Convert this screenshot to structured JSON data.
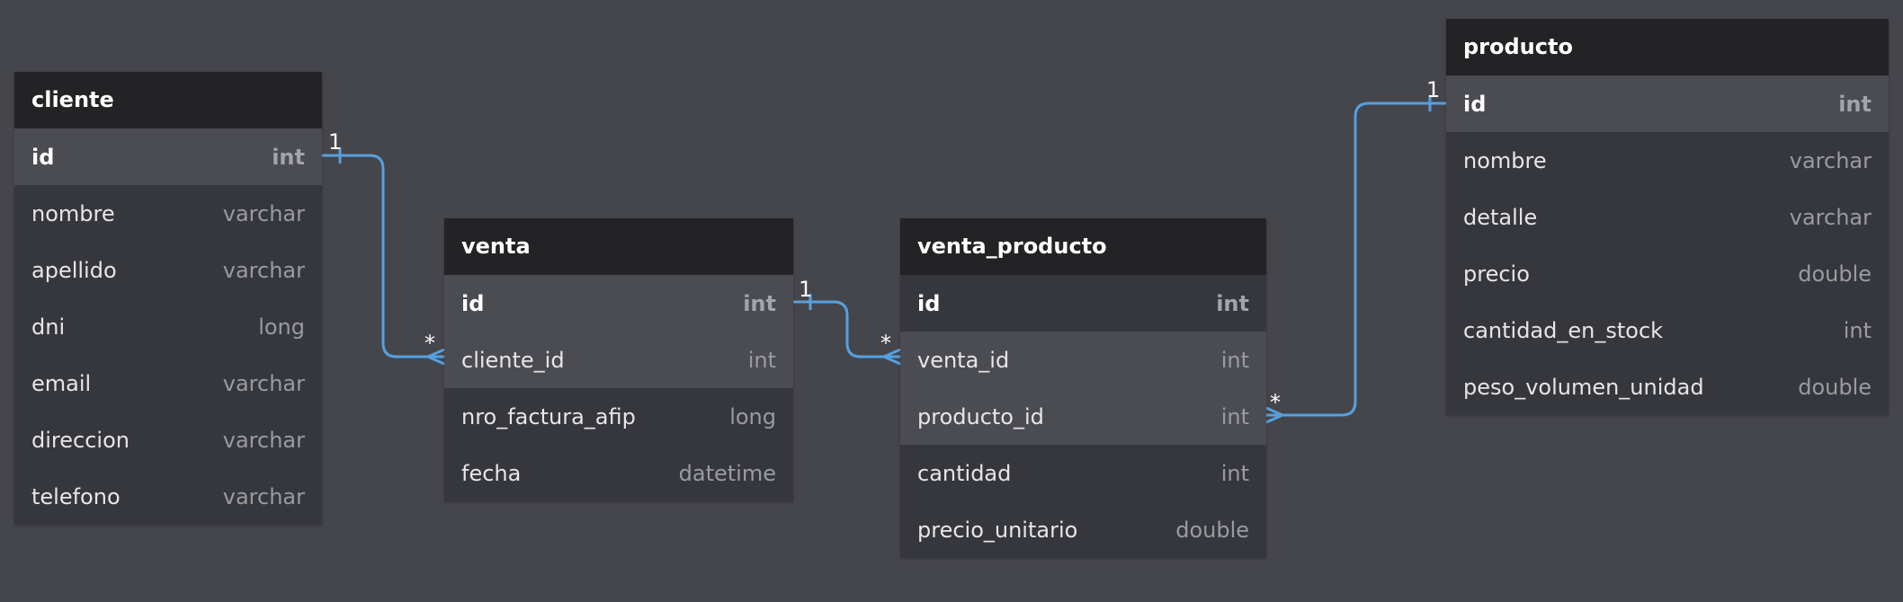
{
  "tables": [
    {
      "id": "cliente",
      "name": "cliente",
      "fields": [
        {
          "name": "id",
          "type": "int",
          "pk": true,
          "highlight": true
        },
        {
          "name": "nombre",
          "type": "varchar"
        },
        {
          "name": "apellido",
          "type": "varchar"
        },
        {
          "name": "dni",
          "type": "long"
        },
        {
          "name": "email",
          "type": "varchar"
        },
        {
          "name": "direccion",
          "type": "varchar"
        },
        {
          "name": "telefono",
          "type": "varchar"
        }
      ]
    },
    {
      "id": "venta",
      "name": "venta",
      "fields": [
        {
          "name": "id",
          "type": "int",
          "pk": true,
          "highlight": true
        },
        {
          "name": "cliente_id",
          "type": "int",
          "highlight": true
        },
        {
          "name": "nro_factura_afip",
          "type": "long"
        },
        {
          "name": "fecha",
          "type": "datetime"
        }
      ]
    },
    {
      "id": "venta_producto",
      "name": "venta_producto",
      "fields": [
        {
          "name": "id",
          "type": "int",
          "pk": true
        },
        {
          "name": "venta_id",
          "type": "int",
          "highlight": true
        },
        {
          "name": "producto_id",
          "type": "int",
          "highlight": true
        },
        {
          "name": "cantidad",
          "type": "int"
        },
        {
          "name": "precio_unitario",
          "type": "double"
        }
      ]
    },
    {
      "id": "producto",
      "name": "producto",
      "fields": [
        {
          "name": "id",
          "type": "int",
          "pk": true,
          "highlight": true
        },
        {
          "name": "nombre",
          "type": "varchar"
        },
        {
          "name": "detalle",
          "type": "varchar"
        },
        {
          "name": "precio",
          "type": "double"
        },
        {
          "name": "cantidad_en_stock",
          "type": "int"
        },
        {
          "name": "peso_volumen_unidad",
          "type": "double"
        }
      ]
    }
  ],
  "relations": [
    {
      "from": "cliente.id",
      "to": "venta.cliente_id",
      "from_card": "1",
      "to_card": "*"
    },
    {
      "from": "venta.id",
      "to": "venta_producto.venta_id",
      "from_card": "1",
      "to_card": "*"
    },
    {
      "from": "producto.id",
      "to": "venta_producto.producto_id",
      "from_card": "1",
      "to_card": "*"
    }
  ],
  "colors": {
    "background": "#45464c",
    "table_body": "#36373c",
    "table_header": "#232325",
    "row_highlight": "#4b4c52",
    "relation_line": "#56a0df"
  }
}
